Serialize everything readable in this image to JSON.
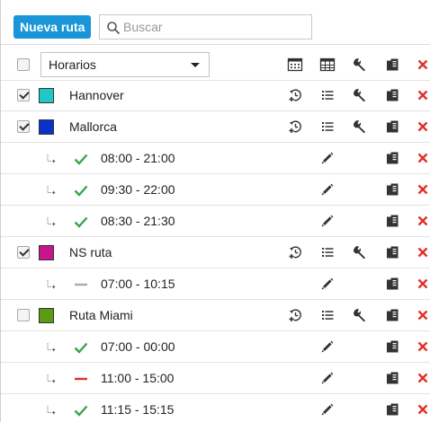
{
  "toolbar": {
    "new_route_label": "Nueva ruta",
    "search_placeholder": "Buscar",
    "search_value": ""
  },
  "header": {
    "select_value": "Horarios",
    "header_icons": [
      "calendar-icon",
      "table-icon",
      "wrench-icon",
      "copy-icon",
      "delete-icon"
    ]
  },
  "colors": {
    "accent": "#1a95d8",
    "delete": "#e0302a",
    "ok": "#3aa54a",
    "partial": "#aaaaaa",
    "disabled": "#e0302a"
  },
  "routes": [
    {
      "name": "Hannover",
      "checked": true,
      "color": "#20c8c8",
      "schedules": []
    },
    {
      "name": "Mallorca",
      "checked": true,
      "color": "#0b32c8",
      "schedules": [
        {
          "time": "08:00 - 21:00",
          "status": "active"
        },
        {
          "time": "09:30 - 22:00",
          "status": "active"
        },
        {
          "time": "08:30 - 21:30",
          "status": "active"
        }
      ]
    },
    {
      "name": "NS ruta",
      "checked": true,
      "color": "#c8158c",
      "schedules": [
        {
          "time": "07:00 - 10:15",
          "status": "neutral"
        }
      ]
    },
    {
      "name": "Ruta Miami",
      "checked": false,
      "color": "#5a9a14",
      "schedules": [
        {
          "time": "07:00 - 00:00",
          "status": "active"
        },
        {
          "time": "11:00 - 15:00",
          "status": "inactive"
        },
        {
          "time": "11:15 - 15:15",
          "status": "active"
        }
      ]
    }
  ]
}
